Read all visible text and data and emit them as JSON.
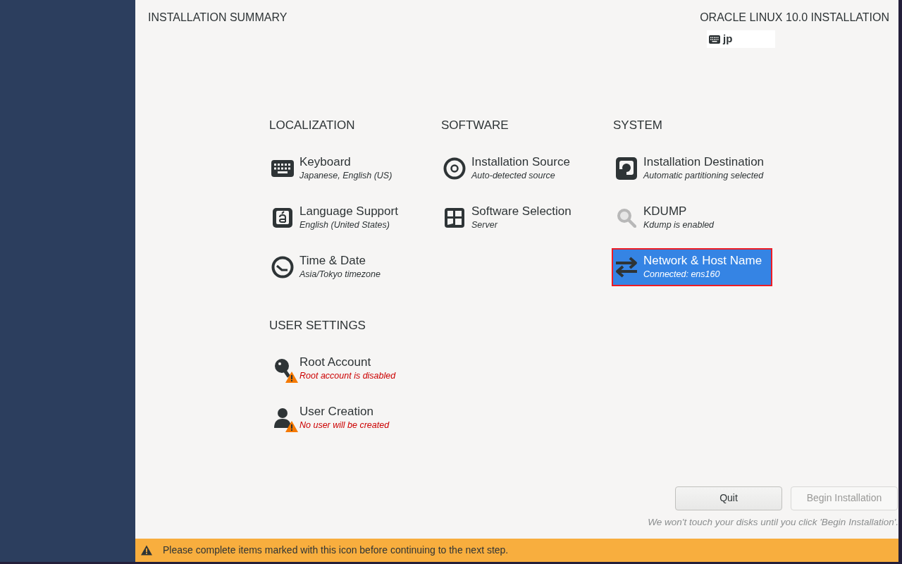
{
  "header": {
    "title": "INSTALLATION SUMMARY",
    "product": "ORACLE LINUX 10.0 INSTALLATION",
    "keyboard_layout": "jp"
  },
  "sections": [
    {
      "title": "LOCALIZATION",
      "spokes": [
        {
          "kind": "keyboard",
          "title": "Keyboard",
          "status": "Japanese, English (US)",
          "warning": false,
          "selected": false
        },
        {
          "kind": "language",
          "title": "Language Support",
          "status": "English (United States)",
          "warning": false,
          "selected": false
        },
        {
          "kind": "clock",
          "title": "Time & Date",
          "status": "Asia/Tokyo timezone",
          "warning": false,
          "selected": false
        }
      ]
    },
    {
      "title": "SOFTWARE",
      "spokes": [
        {
          "kind": "disc",
          "title": "Installation Source",
          "status": "Auto-detected source",
          "warning": false,
          "selected": false
        },
        {
          "kind": "package",
          "title": "Software Selection",
          "status": "Server",
          "warning": false,
          "selected": false
        }
      ]
    },
    {
      "title": "SYSTEM",
      "spokes": [
        {
          "kind": "drive",
          "title": "Installation Destination",
          "status": "Automatic partitioning selected",
          "warning": false,
          "selected": false
        },
        {
          "kind": "magnifier",
          "title": "KDUMP",
          "status": "Kdump is enabled",
          "warning": false,
          "selected": false
        },
        {
          "kind": "network",
          "title": "Network & Host Name",
          "status": "Connected: ens160",
          "warning": false,
          "selected": true
        }
      ]
    },
    {
      "title": "USER SETTINGS",
      "spokes": [
        {
          "kind": "key",
          "title": "Root Account",
          "status": "Root account is disabled",
          "warning": true,
          "selected": false
        },
        {
          "kind": "person",
          "title": "User Creation",
          "status": "No user will be created",
          "warning": true,
          "selected": false
        }
      ]
    }
  ],
  "buttons": [
    {
      "label": "Quit",
      "disabled": false
    },
    {
      "label": "Begin Installation",
      "disabled": true
    }
  ],
  "note": "We won't touch your disks until you click 'Begin Installation'.",
  "warning_bar": {
    "message": "Please complete items marked with this icon before continuing to the next step."
  }
}
